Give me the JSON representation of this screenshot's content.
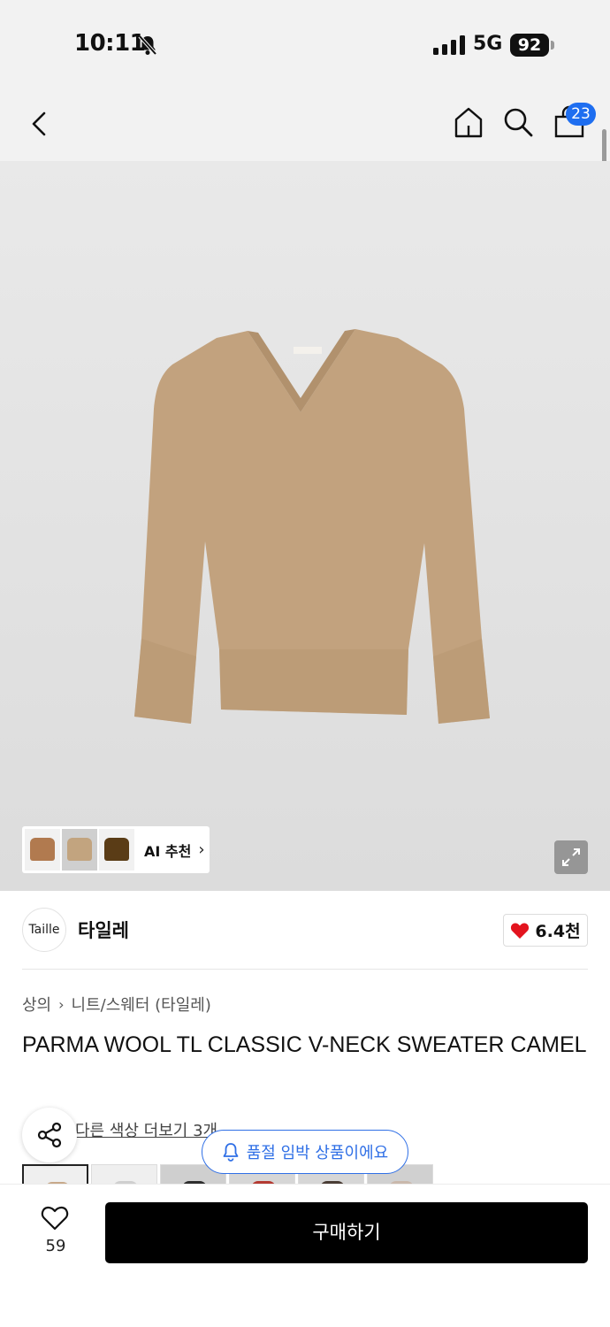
{
  "status_bar": {
    "time": "10:11",
    "network": "5G",
    "battery": "92"
  },
  "nav": {
    "cart_badge": "23",
    "icons": [
      "back-icon",
      "home-icon",
      "search-icon",
      "cart-icon"
    ]
  },
  "ai_recommend": {
    "label": "AI 추천",
    "thumb_colors": [
      "#b17a4f",
      "#c2a47f",
      "#5a3c16"
    ]
  },
  "brand": {
    "logo_text": "Taille",
    "name": "타일레",
    "like_count": "6.4천"
  },
  "breadcrumb": {
    "level1": "상의",
    "level2": "니트/스웨터 (타일레)"
  },
  "product": {
    "title": "PARMA WOOL TL CLASSIC V-NECK SWEATER CAMEL",
    "color_more": "다른 색상 더보기 3개",
    "swatch_colors": [
      "#c7a98a",
      "#cfcfcf",
      "#2e2e2e",
      "#b43a32",
      "#4a3d35",
      "#c9b8ac"
    ]
  },
  "toast": {
    "text": "품절 임박 상품이에요"
  },
  "bottom": {
    "wish_count": "59",
    "buy_label": "구매하기"
  },
  "colors": {
    "accent_blue": "#1e6ef0",
    "heart_red": "#e3141e",
    "sweater_camel": "#c2a27e"
  }
}
